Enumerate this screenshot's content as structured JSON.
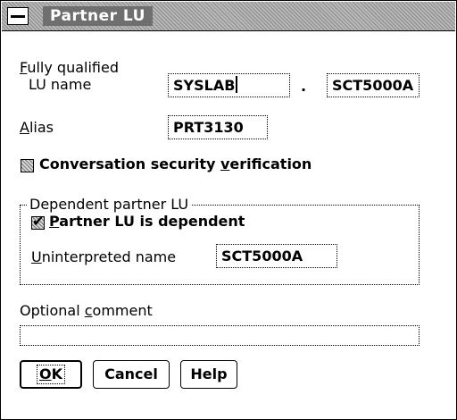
{
  "window": {
    "title": "Partner LU"
  },
  "lu_name": {
    "label_line1": "Fully qualified",
    "label_line1_mnemonic": "F",
    "label_line1_rest": "ully qualified",
    "label_line2": "LU name",
    "network_value": "SYSLAB",
    "separator": ".",
    "lu_value": "SCT5000A"
  },
  "alias": {
    "label_mnemonic": "A",
    "label_rest": "lias",
    "label": "Alias",
    "value": "PRT3130"
  },
  "conversation_security": {
    "label_before": "Conversation security ",
    "label_mnemonic": "v",
    "label_after": "erification",
    "label": "Conversation security verification",
    "checked": false
  },
  "dependent_group": {
    "title": "Dependent partner LU",
    "checkbox": {
      "label_mnemonic": "P",
      "label_rest": "artner LU is dependent",
      "label": "Partner LU is dependent",
      "checked": true
    },
    "uninterpreted": {
      "label_mnemonic": "U",
      "label_rest": "ninterpreted name",
      "label": "Uninterpreted name",
      "value": "SCT5000A"
    }
  },
  "comment": {
    "label_before": "Optional ",
    "label_mnemonic": "c",
    "label_after": "omment",
    "label": "Optional comment",
    "value": ""
  },
  "buttons": {
    "ok": {
      "mnemonic": "O",
      "rest": "K",
      "label": "OK"
    },
    "cancel": "Cancel",
    "help": "Help"
  }
}
